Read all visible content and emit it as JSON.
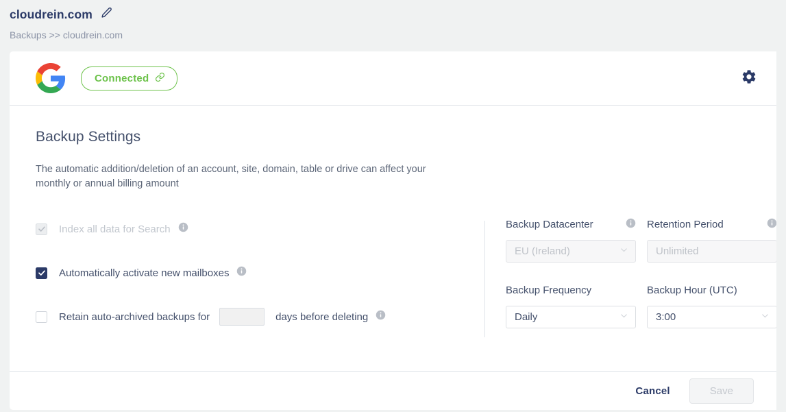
{
  "header": {
    "title": "cloudrein.com",
    "edit_icon": "pencil-icon",
    "breadcrumb": "Backups >> cloudrein.com"
  },
  "card_header": {
    "provider_logo": "google-logo",
    "status_badge": {
      "label": "Connected",
      "icon": "link-icon",
      "color": "#6cc24a"
    },
    "settings_icon": "gear-icon"
  },
  "main": {
    "heading": "Backup Settings",
    "description": "The automatic addition/deletion of an account, site, domain, table or drive can affect your monthly or annual billing amount",
    "options": [
      {
        "label": "Index all data for Search",
        "checked": true,
        "disabled": true,
        "info_icon": "info-icon"
      },
      {
        "label": "Automatically activate new mailboxes",
        "checked": true,
        "disabled": false,
        "info_icon": "info-icon"
      },
      {
        "label": "Retain auto-archived backups for",
        "checked": false,
        "disabled": false,
        "input_value": "",
        "suffix": "days before deleting",
        "info_icon": "info-icon"
      }
    ],
    "fields": [
      {
        "label": "Backup Datacenter",
        "value": "EU (Ireland)",
        "disabled": true,
        "has_chevron": true,
        "info_icon": "info-icon"
      },
      {
        "label": "Retention Period",
        "value": "Unlimited",
        "disabled": true,
        "has_chevron": false,
        "info_icon": "info-icon"
      },
      {
        "label": "Backup Frequency",
        "value": "Daily",
        "disabled": false,
        "has_chevron": true,
        "info_icon": null
      },
      {
        "label": "Backup Hour (UTC)",
        "value": "3:00",
        "disabled": false,
        "has_chevron": true,
        "info_icon": null
      }
    ]
  },
  "footer": {
    "cancel_label": "Cancel",
    "save_label": "Save",
    "save_disabled": true
  }
}
